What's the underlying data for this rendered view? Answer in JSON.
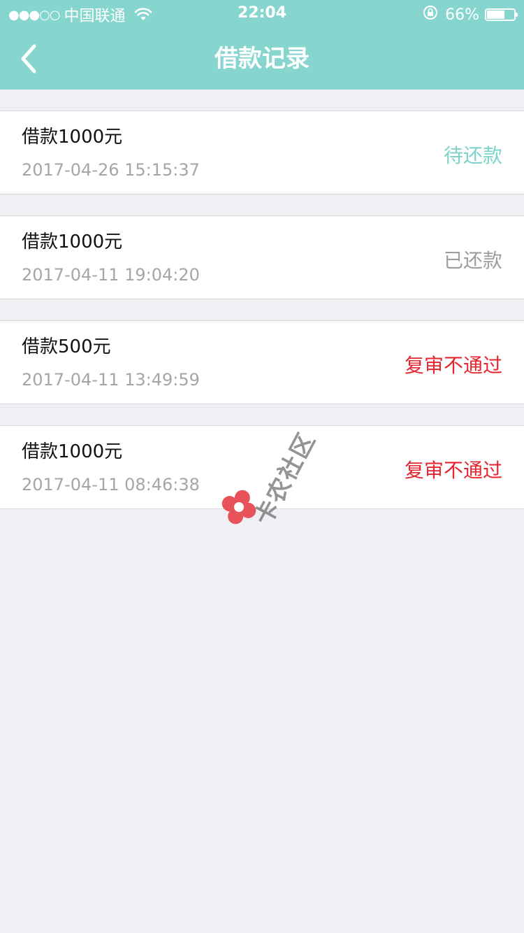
{
  "status_bar": {
    "signal": "●●●○○",
    "carrier": "中国联通",
    "time": "22:04",
    "battery": "66%",
    "battery_level": 0.66
  },
  "nav": {
    "title": "借款记录",
    "back_icon": "chevron-left-icon"
  },
  "records": [
    {
      "amount": "借款1000元",
      "time": "2017-04-26 15:15:37",
      "status": "待还款",
      "status_color": "#7dd3cc"
    },
    {
      "amount": "借款1000元",
      "time": "2017-04-11 19:04:20",
      "status": "已还款",
      "status_color": "#9e9e9e"
    },
    {
      "amount": "借款500元",
      "time": "2017-04-11 13:49:59",
      "status": "复审不通过",
      "status_color": "#e5262f"
    },
    {
      "amount": "借款1000元",
      "time": "2017-04-11 08:46:38",
      "status": "复审不通过",
      "status_color": "#e5262f"
    }
  ],
  "watermark": {
    "text": "卡农社区"
  },
  "colors": {
    "header_bg": "#86d6cf",
    "page_bg": "#efeff4"
  }
}
